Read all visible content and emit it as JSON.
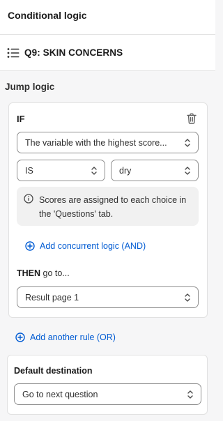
{
  "header": {
    "title": "Conditional logic"
  },
  "question": {
    "title": "Q9: SKIN CONCERNS",
    "icon": "list-icon"
  },
  "jump_logic": {
    "label": "Jump logic",
    "rule": {
      "if_label": "IF",
      "variable_select": "The variable with the highest score...",
      "operator_select": "IS",
      "value_select": "dry",
      "info_text": "Scores are assigned to each choice in the 'Questions' tab.",
      "add_concurrent_label": "Add concurrent logic (AND)",
      "then_bold": "THEN",
      "then_rest": " go to...",
      "destination_select": "Result page 1"
    },
    "add_rule_label": "Add another rule (OR)"
  },
  "default_destination": {
    "label": "Default destination",
    "select": "Go to next question"
  },
  "colors": {
    "link": "#005bd3",
    "text": "#303030",
    "background": "#f6f6f7"
  }
}
